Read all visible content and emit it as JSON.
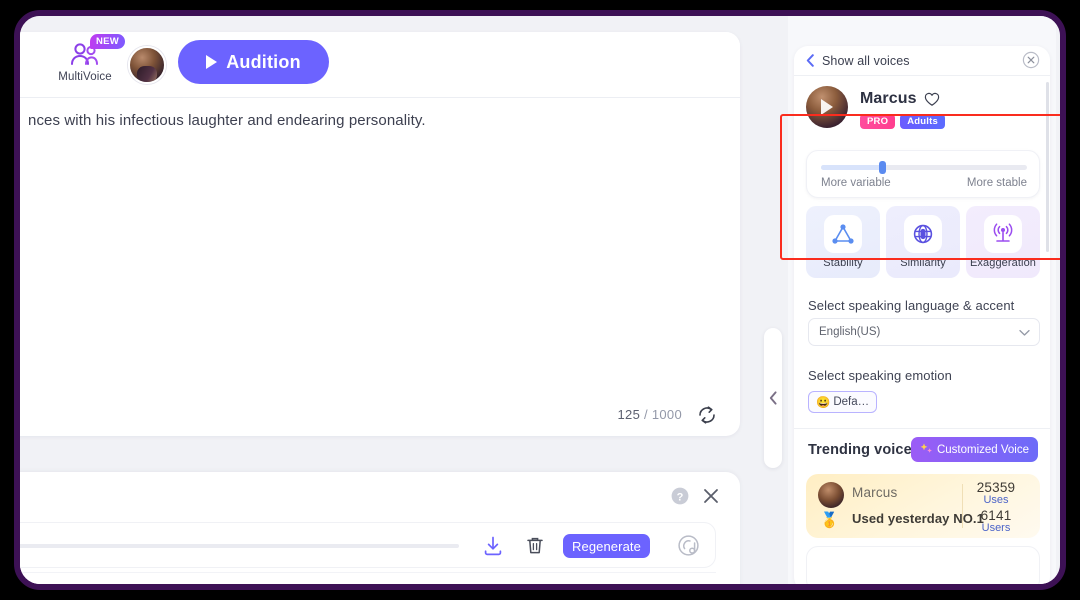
{
  "editor": {
    "multivoice_label": "MultiVoice",
    "new_badge": "NEW",
    "audition_label": "Audition",
    "text": "nces with his infectious laughter and endearing personality.",
    "char_count": "125",
    "char_sep": "/",
    "char_limit": "1000"
  },
  "player": {
    "regenerate_label": "Regenerate"
  },
  "right_panel": {
    "header_title": "Show all voices",
    "voice": {
      "name": "Marcus",
      "badges": [
        "PRO",
        "Adults"
      ]
    },
    "slider": {
      "left_label": "More variable",
      "right_label": "More stable",
      "value": 30
    },
    "features": [
      {
        "label": "Stability",
        "icon": "triangle-nodes-icon"
      },
      {
        "label": "Similarity",
        "icon": "globe-sphere-icon"
      },
      {
        "label": "Exaggeration",
        "icon": "broadcast-tower-icon"
      }
    ],
    "language_section_title": "Select speaking language & accent",
    "language_value": "English(US)",
    "emotion_section_title": "Select speaking emotion",
    "emotion_chip": "Defa…",
    "emotion_chip_emoji": "😀",
    "trending_title": "Trending voices",
    "customized_voice_label": "Customized Voice",
    "trending_items": [
      {
        "name": "Marcus",
        "subtitle": "Used yesterday NO.1",
        "medal": "🥇",
        "stats": [
          {
            "number": "25359",
            "unit": "Uses"
          },
          {
            "number": "6141",
            "unit": "Users"
          }
        ]
      }
    ]
  },
  "colors": {
    "accent": "#6c63ff",
    "highlight_box": "#fa2c1e",
    "frame": "#3d1155",
    "badge_pro": "#ff4d9d",
    "badge_adults": "#6b5cff"
  }
}
